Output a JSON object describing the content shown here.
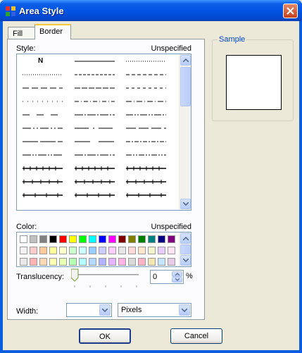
{
  "window": {
    "title": "Area Style",
    "close_icon": "close-icon"
  },
  "tabs": [
    {
      "label": "Fill",
      "selected": false
    },
    {
      "label": "Border",
      "selected": true
    }
  ],
  "style": {
    "label": "Style:",
    "value": "Unspecified",
    "first_item": "N"
  },
  "color": {
    "label": "Color:",
    "value": "Unspecified",
    "row1": [
      "#FFFFFF",
      "#C0C0C0",
      "#808080",
      "#000000",
      "#FF0000",
      "#FFFF00",
      "#00FF00",
      "#00FFFF",
      "#0000FF",
      "#FF00FF",
      "#800000",
      "#808000",
      "#008000",
      "#008080",
      "#000080",
      "#800080"
    ],
    "row2": [
      "#F2F2F2",
      "#FFCCCC",
      "#FFCC99",
      "#FFFF99",
      "#FFFFCC",
      "#CCFFCC",
      "#CCFFFF",
      "#99CCFF",
      "#CCCCFF",
      "#FFCCFF",
      "#E6E6E6",
      "#FFD9D9",
      "#FFE6CC",
      "#F2F2CC",
      "#E6CCFF",
      "#FFE6F2"
    ],
    "row3": [
      "#E8E8E8",
      "#FFB3B3",
      "#FFD9B3",
      "#FFFFB3",
      "#E6FFB3",
      "#B3FFB3",
      "#B3FFFF",
      "#B3D9FF",
      "#B3B3FF",
      "#E6B3FF",
      "#FFB3E6",
      "#D9D9D9",
      "#FFB3C6",
      "#F2E6B3",
      "#C6E6FF",
      "#E6CCE6"
    ]
  },
  "translucency": {
    "label": "Translucency:",
    "value": "0",
    "unit": "%",
    "slider_level": 0
  },
  "width": {
    "label": "Width:",
    "value": "",
    "unit_value": "Pixels"
  },
  "sample": {
    "legend": "Sample"
  },
  "buttons": {
    "ok": "OK",
    "cancel": "Cancel"
  }
}
